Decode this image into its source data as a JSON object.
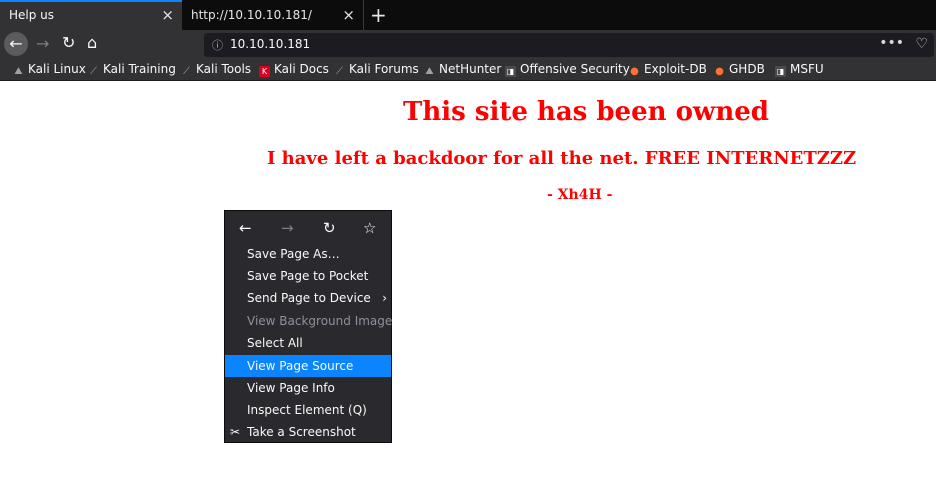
{
  "tabs": [
    {
      "title": "Help us",
      "close_icon": "×"
    },
    {
      "title": "http://10.10.10.181/",
      "close_icon": "×"
    }
  ],
  "newtab_icon": "+",
  "nav": {
    "back_icon": "←",
    "forward_icon": "→",
    "reload_icon": "↻",
    "home_icon": "⌂"
  },
  "urlbar": {
    "info_icon": "ⓘ",
    "url": "10.10.10.181",
    "page_actions_icon": "•••",
    "pocket_icon": "♡"
  },
  "bookmarks": [
    {
      "label": "Kali Linux",
      "icon": "kali-dragon-icon",
      "glyph": "⛰"
    },
    {
      "label": "Kali Training",
      "icon": "kali-dragon-icon",
      "glyph": "⟋"
    },
    {
      "label": "Kali Tools",
      "icon": "kali-dragon-icon",
      "glyph": "⟋"
    },
    {
      "label": "Kali Docs",
      "icon": "kali-docs-icon",
      "glyph": "K"
    },
    {
      "label": "Kali Forums",
      "icon": "kali-dragon-icon",
      "glyph": "⟋"
    },
    {
      "label": "NetHunter",
      "icon": "nethunter-icon",
      "glyph": "⛰"
    },
    {
      "label": "Offensive Security",
      "icon": "offsec-icon",
      "glyph": "◨"
    },
    {
      "label": "Exploit-DB",
      "icon": "exploitdb-icon",
      "glyph": "●"
    },
    {
      "label": "GHDB",
      "icon": "ghdb-icon",
      "glyph": "●"
    },
    {
      "label": "MSFU",
      "icon": "msfu-icon",
      "glyph": "◨"
    }
  ],
  "page": {
    "heading": "This site has been owned",
    "subheading": "I have left a backdoor for all the net. FREE INTERNETZZZ",
    "signature": "- Xh4H -"
  },
  "context_menu": {
    "nav": {
      "back": "←",
      "forward": "→",
      "reload": "↻",
      "bookmark": "☆"
    },
    "items": [
      {
        "label": "Save Page As…",
        "state": "normal"
      },
      {
        "label": "Save Page to Pocket",
        "state": "normal"
      },
      {
        "label": "Send Page to Device",
        "state": "normal",
        "submenu": "›"
      },
      {
        "label": "View Background Image",
        "state": "disabled"
      },
      {
        "label": "Select All",
        "state": "normal"
      },
      {
        "label": "View Page Source",
        "state": "highlighted"
      },
      {
        "label": "View Page Info",
        "state": "normal"
      },
      {
        "label": "Inspect Element (Q)",
        "state": "normal"
      },
      {
        "label": "Take a Screenshot",
        "state": "normal",
        "icon": "✂"
      }
    ]
  },
  "colors": {
    "accent": "#0a84ff",
    "defacement_text": "#ff0000",
    "chrome_dark": "#323234"
  }
}
